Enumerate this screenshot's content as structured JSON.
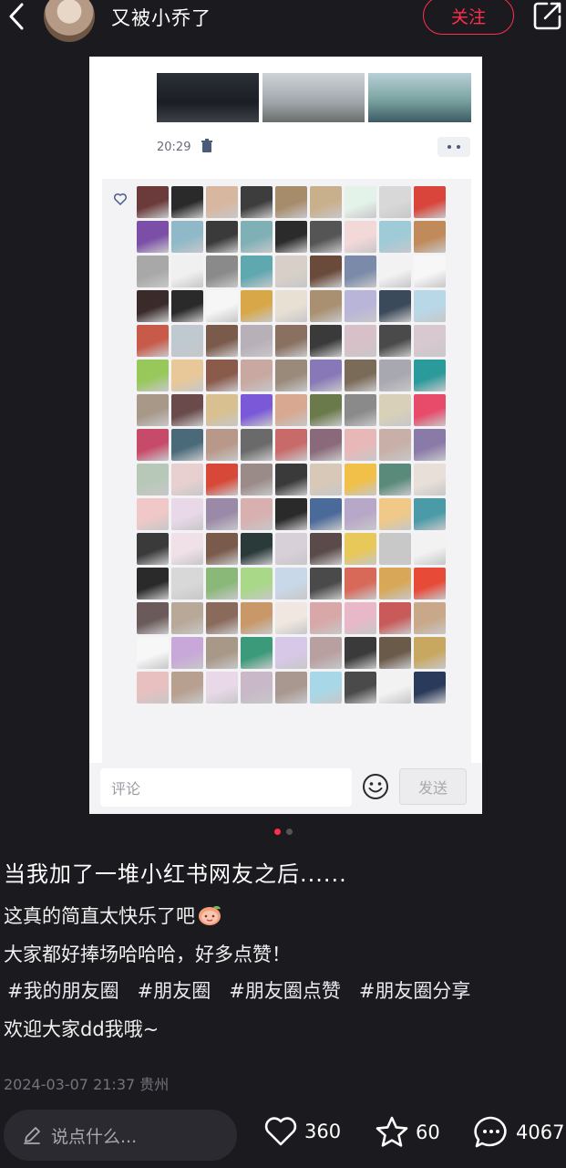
{
  "header": {
    "username": "又被小乔了",
    "follow_label": "关注"
  },
  "card": {
    "post_time": "20:29",
    "comment_placeholder": "评论",
    "send_label": "发送",
    "avatar_colors": [
      [
        "#6b3a3a",
        "#2a2a2a",
        "#d8b7a0",
        "#3d3d3d",
        "#a78c6c",
        "#c9b08c",
        "#e4f3ea",
        "#d8d8d8",
        "#d9453a"
      ],
      [
        "#7b4fa8",
        "#8fb9c9",
        "#3a3a3a",
        "#7fb0b5",
        "#2b2b2b",
        "#555555",
        "#f3d8d8",
        "#9fcbd8",
        "#c08a5a"
      ],
      [
        "#a8a8a8",
        "#f0f0f0",
        "#8a8a8a",
        "#5fa8b0",
        "#d8d0c8",
        "#6a4a3a",
        "#7a8aa8",
        "#f2f2f2",
        "#f7f7f7"
      ],
      [
        "#3a2a2a",
        "#2a2a2a",
        "#f6f6f6",
        "#d8a848",
        "#e9e0d4",
        "#a89070",
        "#b9b5d8",
        "#3b4a5a",
        "#b8d8e8"
      ],
      [
        "#c85a4a",
        "#c0c8d0",
        "#7a5a4a",
        "#b8b0b8",
        "#8a7060",
        "#3a3a3a",
        "#d8c0c8",
        "#4a4a4a",
        "#d8c8d0"
      ],
      [
        "#98c85a",
        "#e8c898",
        "#8a5a4a",
        "#c8a8a0",
        "#9a8a7a",
        "#8878b8",
        "#7a6a58",
        "#a8a8b0",
        "#2a9a9a"
      ],
      [
        "#a89888",
        "#6a4a4a",
        "#d8c090",
        "#7a58d8",
        "#d8a890",
        "#6a7a4a",
        "#8a8a8a",
        "#d8d0b8",
        "#e84a6a"
      ],
      [
        "#c84a6a",
        "#4a6a7a",
        "#b89888",
        "#6a6a6a",
        "#c86a6a",
        "#8a6a7a",
        "#e8b8b8",
        "#c8b0a8",
        "#8a7aa8"
      ],
      [
        "#b8c8b8",
        "#e8d0d0",
        "#d84838",
        "#9a8a88",
        "#3a3a3a",
        "#d8c8b8",
        "#f0c048",
        "#5a8a7a",
        "#e8e0d8"
      ],
      [
        "#f0c8c8",
        "#e8d8e8",
        "#9a8aa8",
        "#d8b0b0",
        "#2a2a2a",
        "#4a6a9a",
        "#b8a8c8",
        "#f0c888",
        "#4a9aa8"
      ],
      [
        "#3a3a3a",
        "#f0e0e8",
        "#7a5a4a",
        "#2a3a3a",
        "#d8d0d8",
        "#5a4a4a",
        "#e8c858",
        "#c8c8c8",
        "#f2f2f2"
      ],
      [
        "#2a2a2a",
        "#d8d8d8",
        "#8ab878",
        "#a8d888",
        "#c8d8e8",
        "#4a4a4a",
        "#d86858",
        "#d8a858",
        "#e84a38"
      ],
      [
        "#6a5a5a",
        "#b8a898",
        "#8a6a5a",
        "#c89868",
        "#f0e8e0",
        "#d8a8a8",
        "#e8b8c8",
        "#c85a5a",
        "#c8a888"
      ],
      [
        "#f7f7f7",
        "#c8a8d8",
        "#a89888",
        "#3a9a7a",
        "#d8c8e8",
        "#b8a0a0",
        "#3a3a3a",
        "#6a5a4a",
        "#c8a860"
      ],
      [
        "#e8c0c0",
        "#b8a090",
        "#e8d8e8",
        "#c8b8c8",
        "#a89890",
        "#a8d8e8",
        "#4a4a4a",
        "#f2f2f2",
        "#2a3a5a"
      ]
    ]
  },
  "post": {
    "title": "当我加了一堆小红书网友之后......",
    "line1": "这真的简直太快乐了吧",
    "line2": "大家都好捧场哈哈哈，好多点赞！",
    "tags": [
      "#我的朋友圈",
      "#朋友圈",
      "#朋友圈点赞",
      "#朋友圈分享"
    ],
    "line4": "欢迎大家dd我哦~",
    "date_location": "2024-03-07 21:37 贵州"
  },
  "carousel": {
    "current_page": 1,
    "total_pages": 2
  },
  "bottom": {
    "say_placeholder": "说点什么...",
    "likes": "360",
    "favorites": "60",
    "comments": "4067"
  }
}
